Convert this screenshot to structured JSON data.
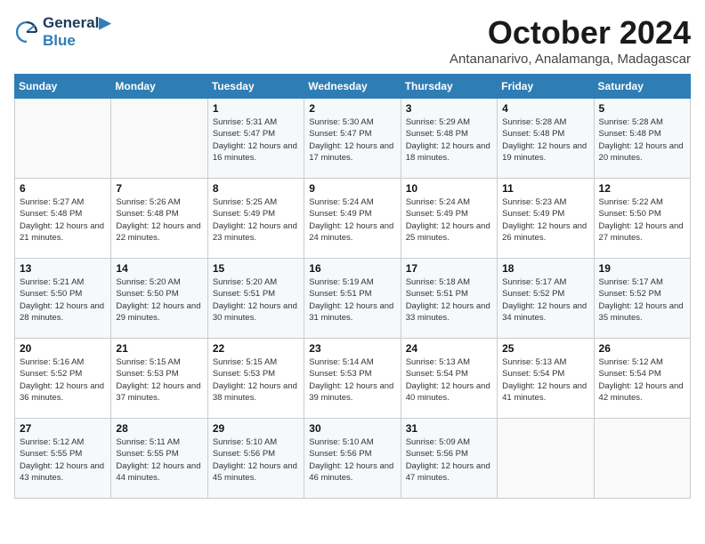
{
  "header": {
    "logo_line1": "General",
    "logo_line2": "Blue",
    "month": "October 2024",
    "location": "Antananarivo, Analamanga, Madagascar"
  },
  "weekdays": [
    "Sunday",
    "Monday",
    "Tuesday",
    "Wednesday",
    "Thursday",
    "Friday",
    "Saturday"
  ],
  "weeks": [
    [
      {
        "day": "",
        "info": ""
      },
      {
        "day": "",
        "info": ""
      },
      {
        "day": "1",
        "info": "Sunrise: 5:31 AM\nSunset: 5:47 PM\nDaylight: 12 hours and 16 minutes."
      },
      {
        "day": "2",
        "info": "Sunrise: 5:30 AM\nSunset: 5:47 PM\nDaylight: 12 hours and 17 minutes."
      },
      {
        "day": "3",
        "info": "Sunrise: 5:29 AM\nSunset: 5:48 PM\nDaylight: 12 hours and 18 minutes."
      },
      {
        "day": "4",
        "info": "Sunrise: 5:28 AM\nSunset: 5:48 PM\nDaylight: 12 hours and 19 minutes."
      },
      {
        "day": "5",
        "info": "Sunrise: 5:28 AM\nSunset: 5:48 PM\nDaylight: 12 hours and 20 minutes."
      }
    ],
    [
      {
        "day": "6",
        "info": "Sunrise: 5:27 AM\nSunset: 5:48 PM\nDaylight: 12 hours and 21 minutes."
      },
      {
        "day": "7",
        "info": "Sunrise: 5:26 AM\nSunset: 5:48 PM\nDaylight: 12 hours and 22 minutes."
      },
      {
        "day": "8",
        "info": "Sunrise: 5:25 AM\nSunset: 5:49 PM\nDaylight: 12 hours and 23 minutes."
      },
      {
        "day": "9",
        "info": "Sunrise: 5:24 AM\nSunset: 5:49 PM\nDaylight: 12 hours and 24 minutes."
      },
      {
        "day": "10",
        "info": "Sunrise: 5:24 AM\nSunset: 5:49 PM\nDaylight: 12 hours and 25 minutes."
      },
      {
        "day": "11",
        "info": "Sunrise: 5:23 AM\nSunset: 5:49 PM\nDaylight: 12 hours and 26 minutes."
      },
      {
        "day": "12",
        "info": "Sunrise: 5:22 AM\nSunset: 5:50 PM\nDaylight: 12 hours and 27 minutes."
      }
    ],
    [
      {
        "day": "13",
        "info": "Sunrise: 5:21 AM\nSunset: 5:50 PM\nDaylight: 12 hours and 28 minutes."
      },
      {
        "day": "14",
        "info": "Sunrise: 5:20 AM\nSunset: 5:50 PM\nDaylight: 12 hours and 29 minutes."
      },
      {
        "day": "15",
        "info": "Sunrise: 5:20 AM\nSunset: 5:51 PM\nDaylight: 12 hours and 30 minutes."
      },
      {
        "day": "16",
        "info": "Sunrise: 5:19 AM\nSunset: 5:51 PM\nDaylight: 12 hours and 31 minutes."
      },
      {
        "day": "17",
        "info": "Sunrise: 5:18 AM\nSunset: 5:51 PM\nDaylight: 12 hours and 33 minutes."
      },
      {
        "day": "18",
        "info": "Sunrise: 5:17 AM\nSunset: 5:52 PM\nDaylight: 12 hours and 34 minutes."
      },
      {
        "day": "19",
        "info": "Sunrise: 5:17 AM\nSunset: 5:52 PM\nDaylight: 12 hours and 35 minutes."
      }
    ],
    [
      {
        "day": "20",
        "info": "Sunrise: 5:16 AM\nSunset: 5:52 PM\nDaylight: 12 hours and 36 minutes."
      },
      {
        "day": "21",
        "info": "Sunrise: 5:15 AM\nSunset: 5:53 PM\nDaylight: 12 hours and 37 minutes."
      },
      {
        "day": "22",
        "info": "Sunrise: 5:15 AM\nSunset: 5:53 PM\nDaylight: 12 hours and 38 minutes."
      },
      {
        "day": "23",
        "info": "Sunrise: 5:14 AM\nSunset: 5:53 PM\nDaylight: 12 hours and 39 minutes."
      },
      {
        "day": "24",
        "info": "Sunrise: 5:13 AM\nSunset: 5:54 PM\nDaylight: 12 hours and 40 minutes."
      },
      {
        "day": "25",
        "info": "Sunrise: 5:13 AM\nSunset: 5:54 PM\nDaylight: 12 hours and 41 minutes."
      },
      {
        "day": "26",
        "info": "Sunrise: 5:12 AM\nSunset: 5:54 PM\nDaylight: 12 hours and 42 minutes."
      }
    ],
    [
      {
        "day": "27",
        "info": "Sunrise: 5:12 AM\nSunset: 5:55 PM\nDaylight: 12 hours and 43 minutes."
      },
      {
        "day": "28",
        "info": "Sunrise: 5:11 AM\nSunset: 5:55 PM\nDaylight: 12 hours and 44 minutes."
      },
      {
        "day": "29",
        "info": "Sunrise: 5:10 AM\nSunset: 5:56 PM\nDaylight: 12 hours and 45 minutes."
      },
      {
        "day": "30",
        "info": "Sunrise: 5:10 AM\nSunset: 5:56 PM\nDaylight: 12 hours and 46 minutes."
      },
      {
        "day": "31",
        "info": "Sunrise: 5:09 AM\nSunset: 5:56 PM\nDaylight: 12 hours and 47 minutes."
      },
      {
        "day": "",
        "info": ""
      },
      {
        "day": "",
        "info": ""
      }
    ]
  ]
}
